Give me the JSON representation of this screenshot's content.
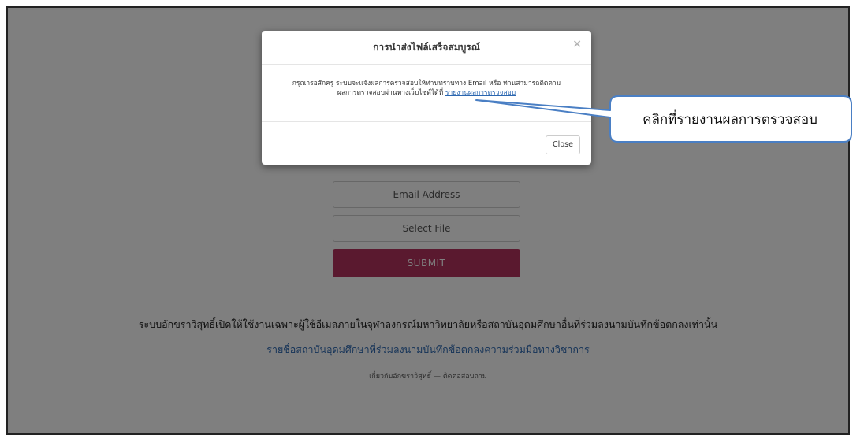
{
  "page": {
    "email_placeholder": "Email Address",
    "select_file_label": "Select File",
    "submit_label": "SUBMIT",
    "notice_text": "ระบบอักขราวิสุทธิ์เปิดให้ใช้งานเฉพาะผู้ใช้อีเมลภายในจุฬาลงกรณ์มหาวิทยาลัยหรือสถาบันอุดมศึกษาอื่นที่ร่วมลงนามบันทึกข้อตกลงเท่านั้น",
    "partners_link": "รายชื่อสถาบันอุดมศึกษาที่ร่วมลงนามบันทึกข้อตกลงความร่วมมือทางวิชาการ",
    "footer_about": "เกี่ยวกับอักขราวิสุทธิ์",
    "footer_separator": "—",
    "footer_contact": "ติดต่อสอบถาม"
  },
  "modal": {
    "title": "การนำส่งไฟล์เสร็จสมบูรณ์",
    "close_x": "×",
    "body_line1": "กรุณารอสักครู่ ระบบจะแจ้งผลการตรวจสอบให้ท่านทราบทาง Email หรือ ท่านสามารถติดตาม",
    "body_line2_prefix": "ผลการตรวจสอบผ่านทางเว็บไซต์ได้ที่",
    "body_link": "รายงานผลการตรวจสอบ",
    "close_button": "Close"
  },
  "callout": {
    "text": "คลิกที่รายงานผลการตรวจสอบ",
    "border_color": "#4a7fc4"
  }
}
